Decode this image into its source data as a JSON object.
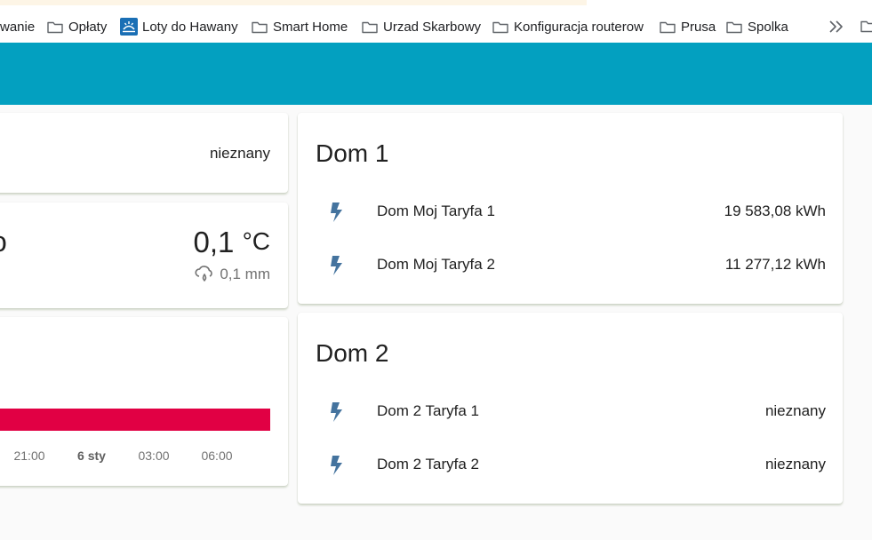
{
  "bookmarks": {
    "items": [
      {
        "label": "wanie",
        "icon": "none"
      },
      {
        "label": "Opłaty",
        "icon": "folder-icon"
      },
      {
        "label": "Loty do Hawany",
        "icon": "favicon-icon"
      },
      {
        "label": "Smart Home",
        "icon": "folder-icon"
      },
      {
        "label": "Urzad Skarbowy",
        "icon": "folder-icon"
      },
      {
        "label": "Konfiguracja routerow",
        "icon": "folder-icon"
      },
      {
        "label": "Prusa",
        "icon": "folder-icon"
      },
      {
        "label": "Spolka",
        "icon": "folder-icon"
      }
    ],
    "more_icon": "chevron-double-right-icon"
  },
  "header": {
    "color": "#03a0c0"
  },
  "left_cards": {
    "state_card": {
      "state": "nieznany"
    },
    "weather_card": {
      "condition_cutoff": "o",
      "temperature": "0,1",
      "temperature_unit": "°C",
      "precipitation": "0,1 mm",
      "precip_icon": "weather-pouring-icon"
    },
    "history_card": {
      "bar_color": "#e10044",
      "ticks": [
        "21:00",
        "6 sty",
        "03:00",
        "06:00"
      ]
    }
  },
  "energy_cards": [
    {
      "title": "Dom 1",
      "entities": [
        {
          "name": "Dom Moj Taryfa 1",
          "value": "19 583,08 kWh",
          "icon": "flash-icon"
        },
        {
          "name": "Dom Moj Taryfa 2",
          "value": "11 277,12 kWh",
          "icon": "flash-icon"
        }
      ]
    },
    {
      "title": "Dom 2",
      "entities": [
        {
          "name": "Dom 2 Taryfa 1",
          "value": "nieznany",
          "icon": "flash-icon"
        },
        {
          "name": "Dom 2 Taryfa 2",
          "value": "nieznany",
          "icon": "flash-icon"
        }
      ]
    }
  ],
  "colors": {
    "icon": "#44739e",
    "accent_bar": "#e10044",
    "header": "#03a0c0"
  }
}
